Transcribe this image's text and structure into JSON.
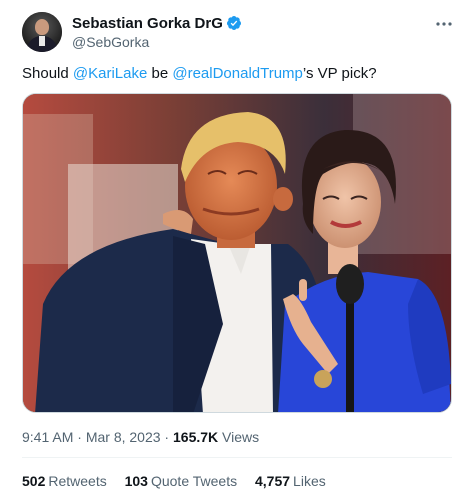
{
  "author": {
    "display_name": "Sebastian Gorka DrG",
    "handle": "@SebGorka",
    "verified_icon": "verified-badge-icon",
    "badge_color": "#1d9bf0"
  },
  "tweet": {
    "text_prefix": "Should ",
    "mention_1": "@KariLake",
    "text_middle": " be ",
    "mention_2": "@realDonaldTrump",
    "text_suffix": "’s VP pick?",
    "link_color": "#1d9bf0"
  },
  "meta": {
    "time": "9:41 AM",
    "separator_1": " · ",
    "date": "Mar 8, 2023",
    "separator_2": " · ",
    "views_count": "165.7K",
    "views_label": "Views"
  },
  "stats": {
    "retweets_count": "502",
    "retweets_label": "Retweets",
    "quotes_count": "103",
    "quotes_label": "Quote Tweets",
    "likes_count": "4,757",
    "likes_label": "Likes"
  },
  "icons": {
    "more": "more-options-icon"
  }
}
